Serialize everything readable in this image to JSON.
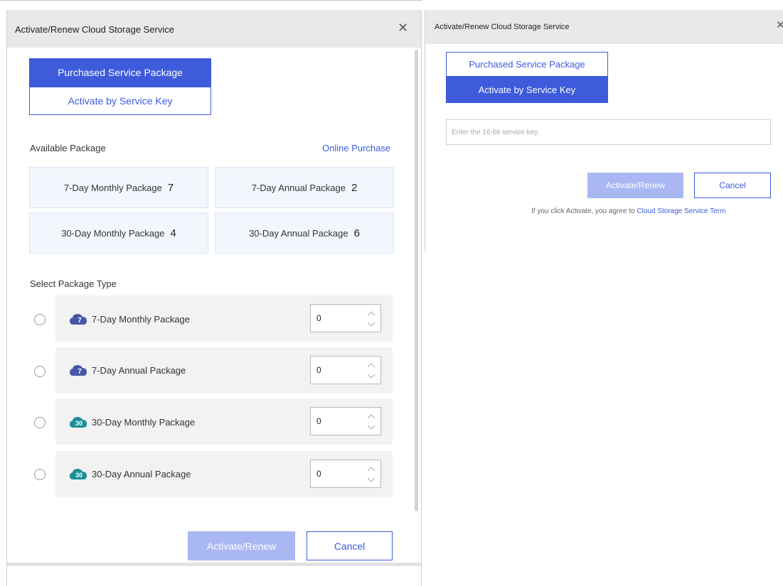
{
  "left": {
    "title": "Activate/Renew Cloud Storage Service",
    "tabs": [
      "Purchased Service Package",
      "Activate by Service Key"
    ],
    "available_label": "Available Package",
    "online_purchase": "Online Purchase",
    "available": [
      {
        "name": "7-Day Monthly Package",
        "count": "7"
      },
      {
        "name": "7-Day Annual Package",
        "count": "2"
      },
      {
        "name": "30-Day Monthly Package",
        "count": "4"
      },
      {
        "name": "30-Day Annual Package",
        "count": "6"
      }
    ],
    "select_label": "Select Package Type",
    "types": [
      {
        "name": "7-Day Monthly Package",
        "badge": "7",
        "color": "#4a56a8",
        "qty": "0"
      },
      {
        "name": "7-Day Annual Package",
        "badge": "7",
        "color": "#4a56a8",
        "qty": "0"
      },
      {
        "name": "30-Day Monthly Package",
        "badge": "30",
        "color": "#1a8f9a",
        "qty": "0"
      },
      {
        "name": "30-Day Annual Package",
        "badge": "30",
        "color": "#1a8f9a",
        "qty": "0"
      }
    ],
    "activate": "Activate/Renew",
    "cancel": "Cancel"
  },
  "right": {
    "title": "Activate/Renew Cloud Storage Service",
    "tabs": [
      "Purchased Service Package",
      "Activate by Service Key"
    ],
    "key_placeholder": "Enter the 16-bit service key.",
    "activate": "Activate/Renew",
    "cancel": "Cancel",
    "agree_text": "If you click Activate, you agree to ",
    "agree_link": "Cloud Storage Service Term"
  },
  "colors": {
    "accent": "#3d5bdb",
    "disabled": "#a9b8f2",
    "card_bg": "#f3f7fd"
  },
  "icons": {
    "close": "close-icon",
    "cloud": "cloud-icon",
    "radio": "radio-icon"
  }
}
